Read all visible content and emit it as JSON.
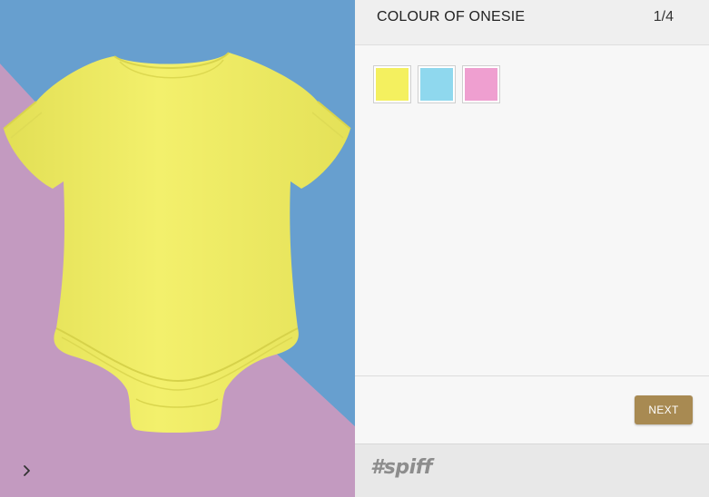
{
  "step": {
    "title": "COLOUR OF ONESIE",
    "counter": "1/4"
  },
  "swatches": [
    {
      "name": "yellow",
      "color": "#f4f05f"
    },
    {
      "name": "blue",
      "color": "#8fd8ee"
    },
    {
      "name": "pink",
      "color": "#ef9fd0"
    }
  ],
  "actions": {
    "next_label": "NEXT"
  },
  "footer": {
    "brand": "#spiff"
  },
  "preview": {
    "garment_color": "#f1ee6a",
    "background_top": "#6aa6d3",
    "background_bottom": "#c39ac0",
    "nav_icon": "chevron-right-icon"
  }
}
